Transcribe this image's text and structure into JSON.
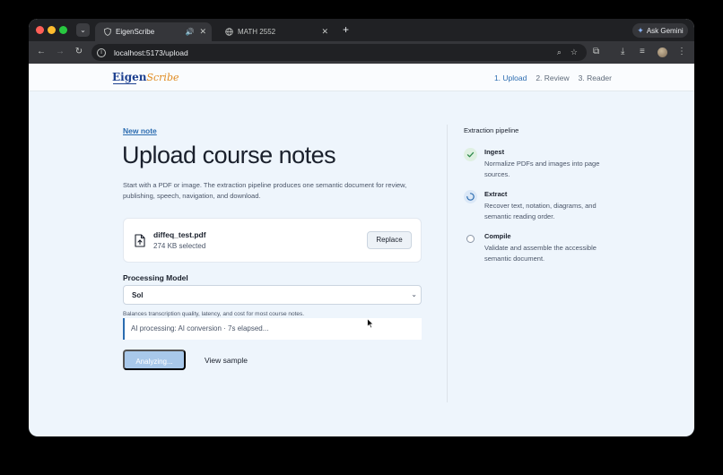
{
  "browser": {
    "tabs": [
      {
        "title": "EigenScribe",
        "active": true
      },
      {
        "title": "MATH 2552",
        "active": false
      }
    ],
    "url": "localhost:5173/upload",
    "ask_gemini": "Ask Gemini"
  },
  "app": {
    "logo_main": "Eigen",
    "logo_accent": "Scribe",
    "steps": [
      "1. Upload",
      "2. Review",
      "3. Reader"
    ]
  },
  "upload": {
    "new_note": "New note",
    "title": "Upload course notes",
    "description": "Start with a PDF or image. The extraction pipeline produces one semantic document for review, publishing, speech, navigation, and download.",
    "file": {
      "name": "diffeq_test.pdf",
      "size": "274 KB selected",
      "replace": "Replace"
    },
    "model_label": "Processing Model",
    "model_value": "Sol",
    "model_help": "Balances transcription quality, latency, and cost for most course notes.",
    "status": "AI processing: AI conversion · 7s elapsed...",
    "analyze_button": "Analyzing...",
    "view_sample": "View sample"
  },
  "pipeline": {
    "title": "Extraction pipeline",
    "items": [
      {
        "name": "Ingest",
        "desc": "Normalize PDFs and images into page sources.",
        "state": "done"
      },
      {
        "name": "Extract",
        "desc": "Recover text, notation, diagrams, and semantic reading order.",
        "state": "running"
      },
      {
        "name": "Compile",
        "desc": "Validate and assemble the accessible semantic document.",
        "state": "pending"
      }
    ]
  }
}
